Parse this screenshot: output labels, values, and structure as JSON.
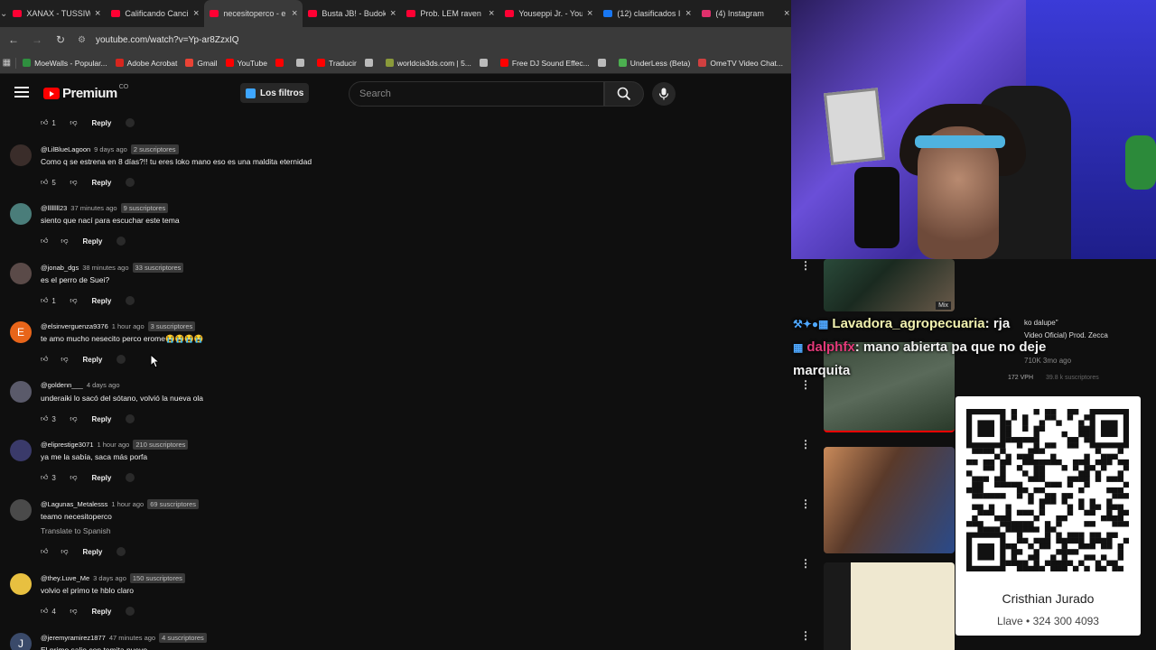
{
  "browser": {
    "tabs": [
      {
        "title": "XANAX - TUSSIW",
        "favicon_color": "#ff0033"
      },
      {
        "title": "Calificando Canci",
        "favicon_color": "#ff0033"
      },
      {
        "title": "necesitoperco - e",
        "favicon_color": "#ff0033",
        "active": true
      },
      {
        "title": "Busta JB! - Budok",
        "favicon_color": "#ff0033"
      },
      {
        "title": "Prob. LEM raven",
        "favicon_color": "#ff0033"
      },
      {
        "title": "Youseppi Jr. - You",
        "favicon_color": "#ff0033"
      },
      {
        "title": "(12) clasificados I",
        "favicon_color": "#1877f2"
      },
      {
        "title": "(4) Instagram",
        "favicon_color": "#e1306c"
      }
    ],
    "url": "youtube.com/watch?v=Yp-ar8ZzxIQ",
    "bookmarks": [
      {
        "label": "MoeWalls - Popular...",
        "color": "#2f8f3f"
      },
      {
        "label": "Adobe Acrobat",
        "color": "#d7261e"
      },
      {
        "label": "Gmail",
        "color": "#ea4335"
      },
      {
        "label": "YouTube",
        "color": "#ff0000"
      },
      {
        "label": "",
        "color": "#ff0000"
      },
      {
        "label": "",
        "color": "#bbbbbb"
      },
      {
        "label": "Traducir",
        "color": "#ff0000"
      },
      {
        "label": "",
        "color": "#bbbbbb"
      },
      {
        "label": "worldcia3ds.com | 5...",
        "color": "#8a9a3a"
      },
      {
        "label": "",
        "color": "#bbbbbb"
      },
      {
        "label": "Free DJ Sound Effec...",
        "color": "#ff0000"
      },
      {
        "label": "",
        "color": "#bbbbbb"
      },
      {
        "label": "UnderLess (Beta)",
        "color": "#4caf50"
      },
      {
        "label": "OmeTV Video Chat...",
        "color": "#d04040"
      }
    ]
  },
  "youtube": {
    "logo_text": "Premium",
    "logo_suffix": "CO",
    "filters_label": "Los filtros",
    "search_placeholder": "Search"
  },
  "comments": {
    "top_actions": {
      "likes": "1",
      "reply": "Reply"
    },
    "items": [
      {
        "author": "@LilBlueLagoon",
        "time": "9 days ago",
        "badge": "2 suscriptores",
        "text": "Como q se estrena en 8 días?!! tu eres loko mano eso es una maldita eternidad",
        "likes": "5",
        "reply": "Reply",
        "avatar_color": "#3a2d2a"
      },
      {
        "author": "@llllllll23",
        "time": "37 minutes ago",
        "badge": "9 suscriptores",
        "text": "siento que nací para escuchar este tema",
        "likes": "",
        "reply": "Reply",
        "avatar_color": "#4a7d7a"
      },
      {
        "author": "@jonab_dgs",
        "time": "38 minutes ago",
        "badge": "33 suscriptores",
        "text": "es el perro de Suei?",
        "likes": "1",
        "reply": "Reply",
        "avatar_color": "#5a4a48"
      },
      {
        "author": "@elsinverguenza9376",
        "time": "1 hour ago",
        "badge": "3 suscriptores",
        "text": "te amo mucho nesecito perco erome😭😭😭😭",
        "likes": "",
        "reply": "Reply",
        "avatar_color": "#e8651a",
        "avatar_letter": "E"
      },
      {
        "author": "@goldenn___",
        "time": "4 days ago",
        "badge": "",
        "text": "underaiki lo sacó del sótano, volvió la nueva ola",
        "likes": "3",
        "reply": "Reply",
        "avatar_color": "#5a5a6a"
      },
      {
        "author": "@eliprestige3071",
        "time": "1 hour ago",
        "badge": "210 suscriptores",
        "text": "ya me la sabía, saca más porfa",
        "likes": "3",
        "reply": "Reply",
        "avatar_color": "#3a3a6a"
      },
      {
        "author": "@Lagunas_Metalesss",
        "time": "1 hour ago",
        "badge": "69 suscriptores",
        "text": "teamo necesitoperco",
        "translate": "Translate to Spanish",
        "likes": "",
        "reply": "Reply",
        "avatar_color": "#4a4a4a"
      },
      {
        "author": "@they.Luve_Me",
        "time": "3 days ago",
        "badge": "150 suscriptores",
        "text": "volvio el primo te hblo claro",
        "likes": "4",
        "reply": "Reply",
        "avatar_color": "#e8c040"
      },
      {
        "author": "@jeremyramirez1877",
        "time": "47 minutes ago",
        "badge": "4 suscriptores",
        "text": "El primo salio con temita nuevo",
        "likes": "",
        "reply": "",
        "avatar_color": "#3a4a6a",
        "avatar_letter": "J"
      }
    ]
  },
  "overlay": {
    "chat": [
      {
        "user": "Lavadora_agropecuaria",
        "message": ": rja",
        "user_color": "#f2f2b0"
      },
      {
        "user": "dalphfx",
        "message": ": mano abierta pa que no deje",
        "continuation": "marquita",
        "user_color": "#e33a7a"
      }
    ],
    "thumb_meta": {
      "mix_label": "Mix",
      "title_fragment": "Video Oficial) Prod. Zecca",
      "title_top": "ko  dalupe\"",
      "stats": "710K  3mo ago",
      "vph": "172 VPH",
      "subs": "39.8 k suscriptores"
    },
    "qr": {
      "name": "Cristhian Jurado",
      "subtitle": "Llave • 324 300 4093"
    }
  }
}
